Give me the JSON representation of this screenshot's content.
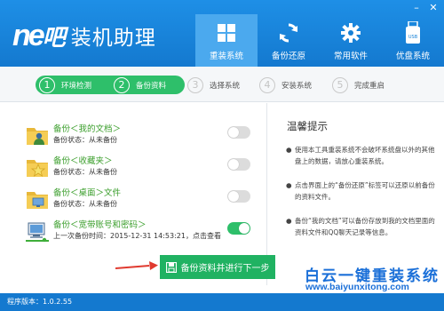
{
  "app": {
    "logo_mark": "ne",
    "logo_mark_small": "吧",
    "title": "装机助理"
  },
  "window": {
    "min_label": "–",
    "close_label": "✕"
  },
  "nav": [
    {
      "label": "重装系统",
      "icon": "windows-icon",
      "active": true
    },
    {
      "label": "备份还原",
      "icon": "refresh-icon",
      "active": false
    },
    {
      "label": "常用软件",
      "icon": "gear-icon",
      "active": false
    },
    {
      "label": "优盘系统",
      "icon": "usb-icon",
      "active": false
    }
  ],
  "steps": [
    {
      "num": "1",
      "label": "环境检测",
      "state": "done"
    },
    {
      "num": "2",
      "label": "备份资料",
      "state": "current"
    },
    {
      "num": "3",
      "label": "选择系统",
      "state": "todo"
    },
    {
      "num": "4",
      "label": "安装系统",
      "state": "todo"
    },
    {
      "num": "5",
      "label": "完成重启",
      "state": "todo"
    }
  ],
  "backup_items": [
    {
      "title": "备份＜我的文档＞",
      "status": "备份状态：从未备份",
      "icon": "folder-user-icon",
      "enabled": false
    },
    {
      "title": "备份＜收藏夹＞",
      "status": "备份状态：从未备份",
      "icon": "folder-star-icon",
      "enabled": false
    },
    {
      "title": "备份＜桌面＞文件",
      "status": "备份状态：从未备份",
      "icon": "folder-desktop-icon",
      "enabled": false
    },
    {
      "title": "备份＜宽带账号和密码＞",
      "status": "上一次备份时间：2015-12-31 14:53:21，点击查看",
      "icon": "network-computer-icon",
      "enabled": true
    }
  ],
  "tips": {
    "title": "温馨提示",
    "items": [
      "使用本工具重装系统不会破坏系统盘以外的其他盘上的数据，请放心重装系统。",
      "点击界面上的“备份还原”标签可以还原以前备份的资料文件。",
      "备份“我的文档”可以备份存放到我的文档里面的资料文件和QQ聊天记录等信息。"
    ],
    "bullet": "●"
  },
  "actions": {
    "next_label": "备份资料并进行下一步"
  },
  "watermark": {
    "title": "白云一键重装系统",
    "url": "www.baiyunxitong.com"
  },
  "footer": {
    "version": "程序版本：1.0.2.55"
  },
  "colors": {
    "primary": "#1479cf",
    "accent_green": "#2ebf6a",
    "button_green": "#20b262",
    "arrow_red": "#e03a2f"
  }
}
